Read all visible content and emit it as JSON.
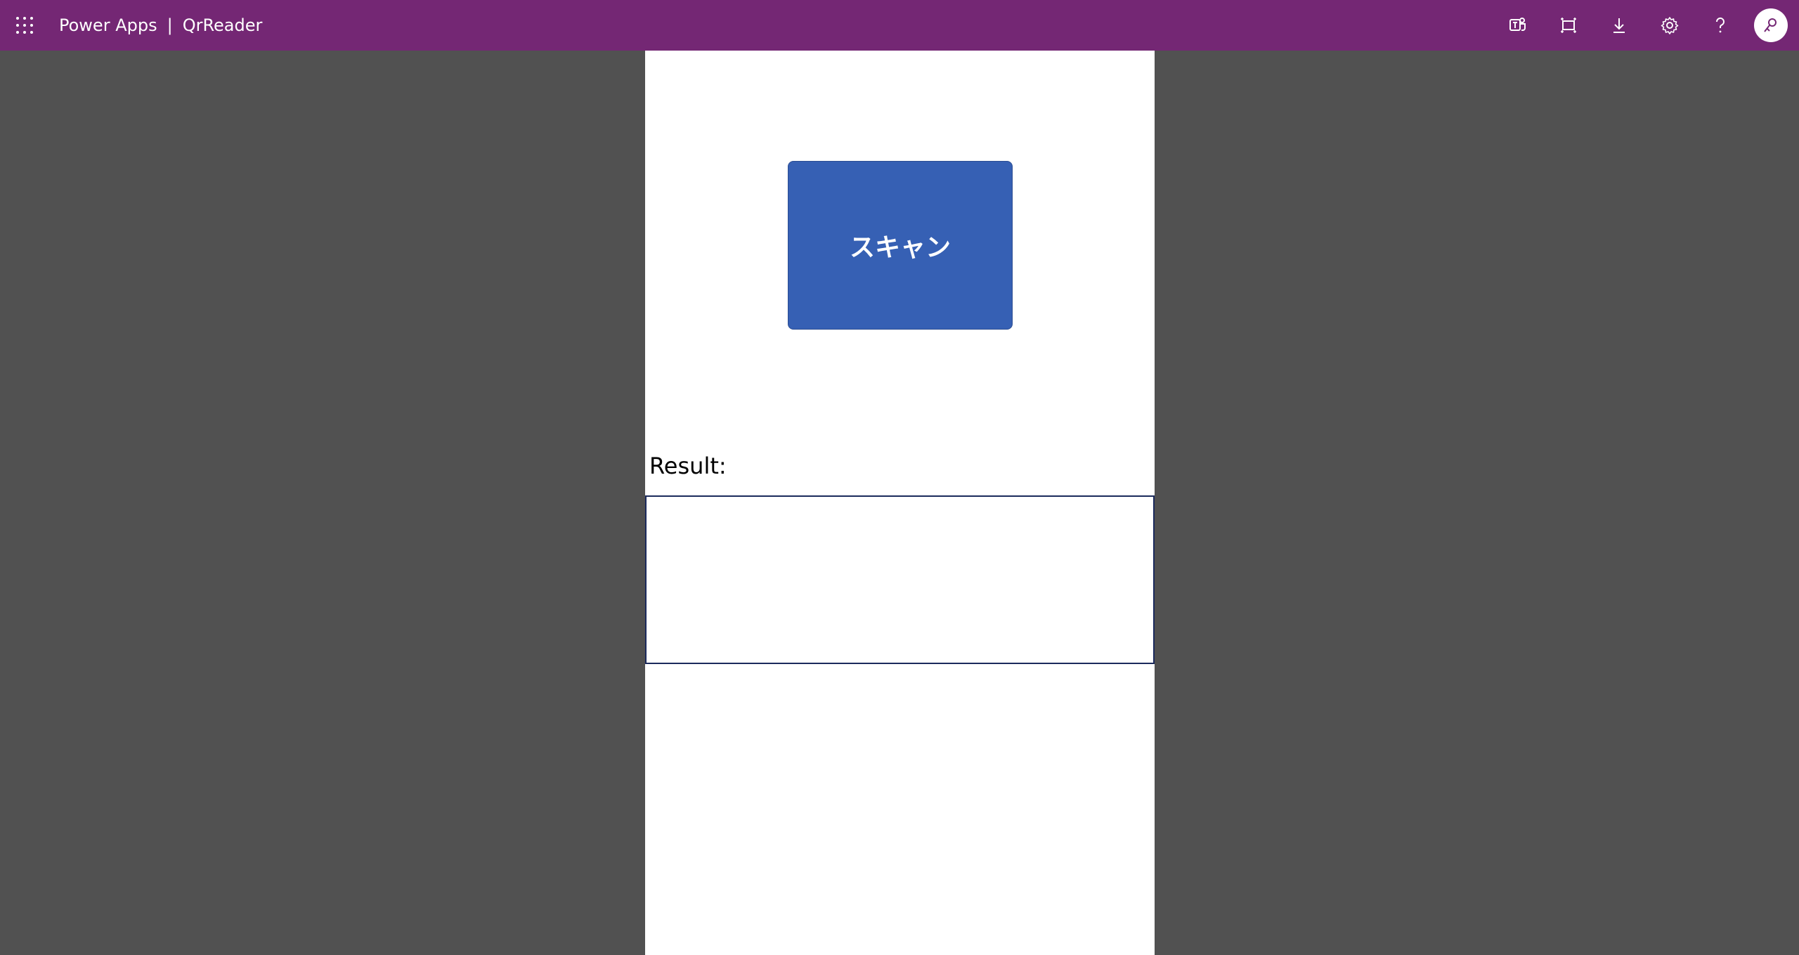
{
  "header": {
    "app_name": "Power Apps",
    "separator": "|",
    "app_title": "QrReader",
    "background_color": "#742774",
    "icons": [
      {
        "name": "teams-icon"
      },
      {
        "name": "fit-to-window-icon"
      },
      {
        "name": "download-icon"
      },
      {
        "name": "settings-icon"
      },
      {
        "name": "help-icon"
      },
      {
        "name": "user-avatar"
      }
    ]
  },
  "screen": {
    "scan_button_label": "スキャン",
    "scan_button_color": "#3660b4",
    "result_label": "Result:",
    "result_value": ""
  }
}
